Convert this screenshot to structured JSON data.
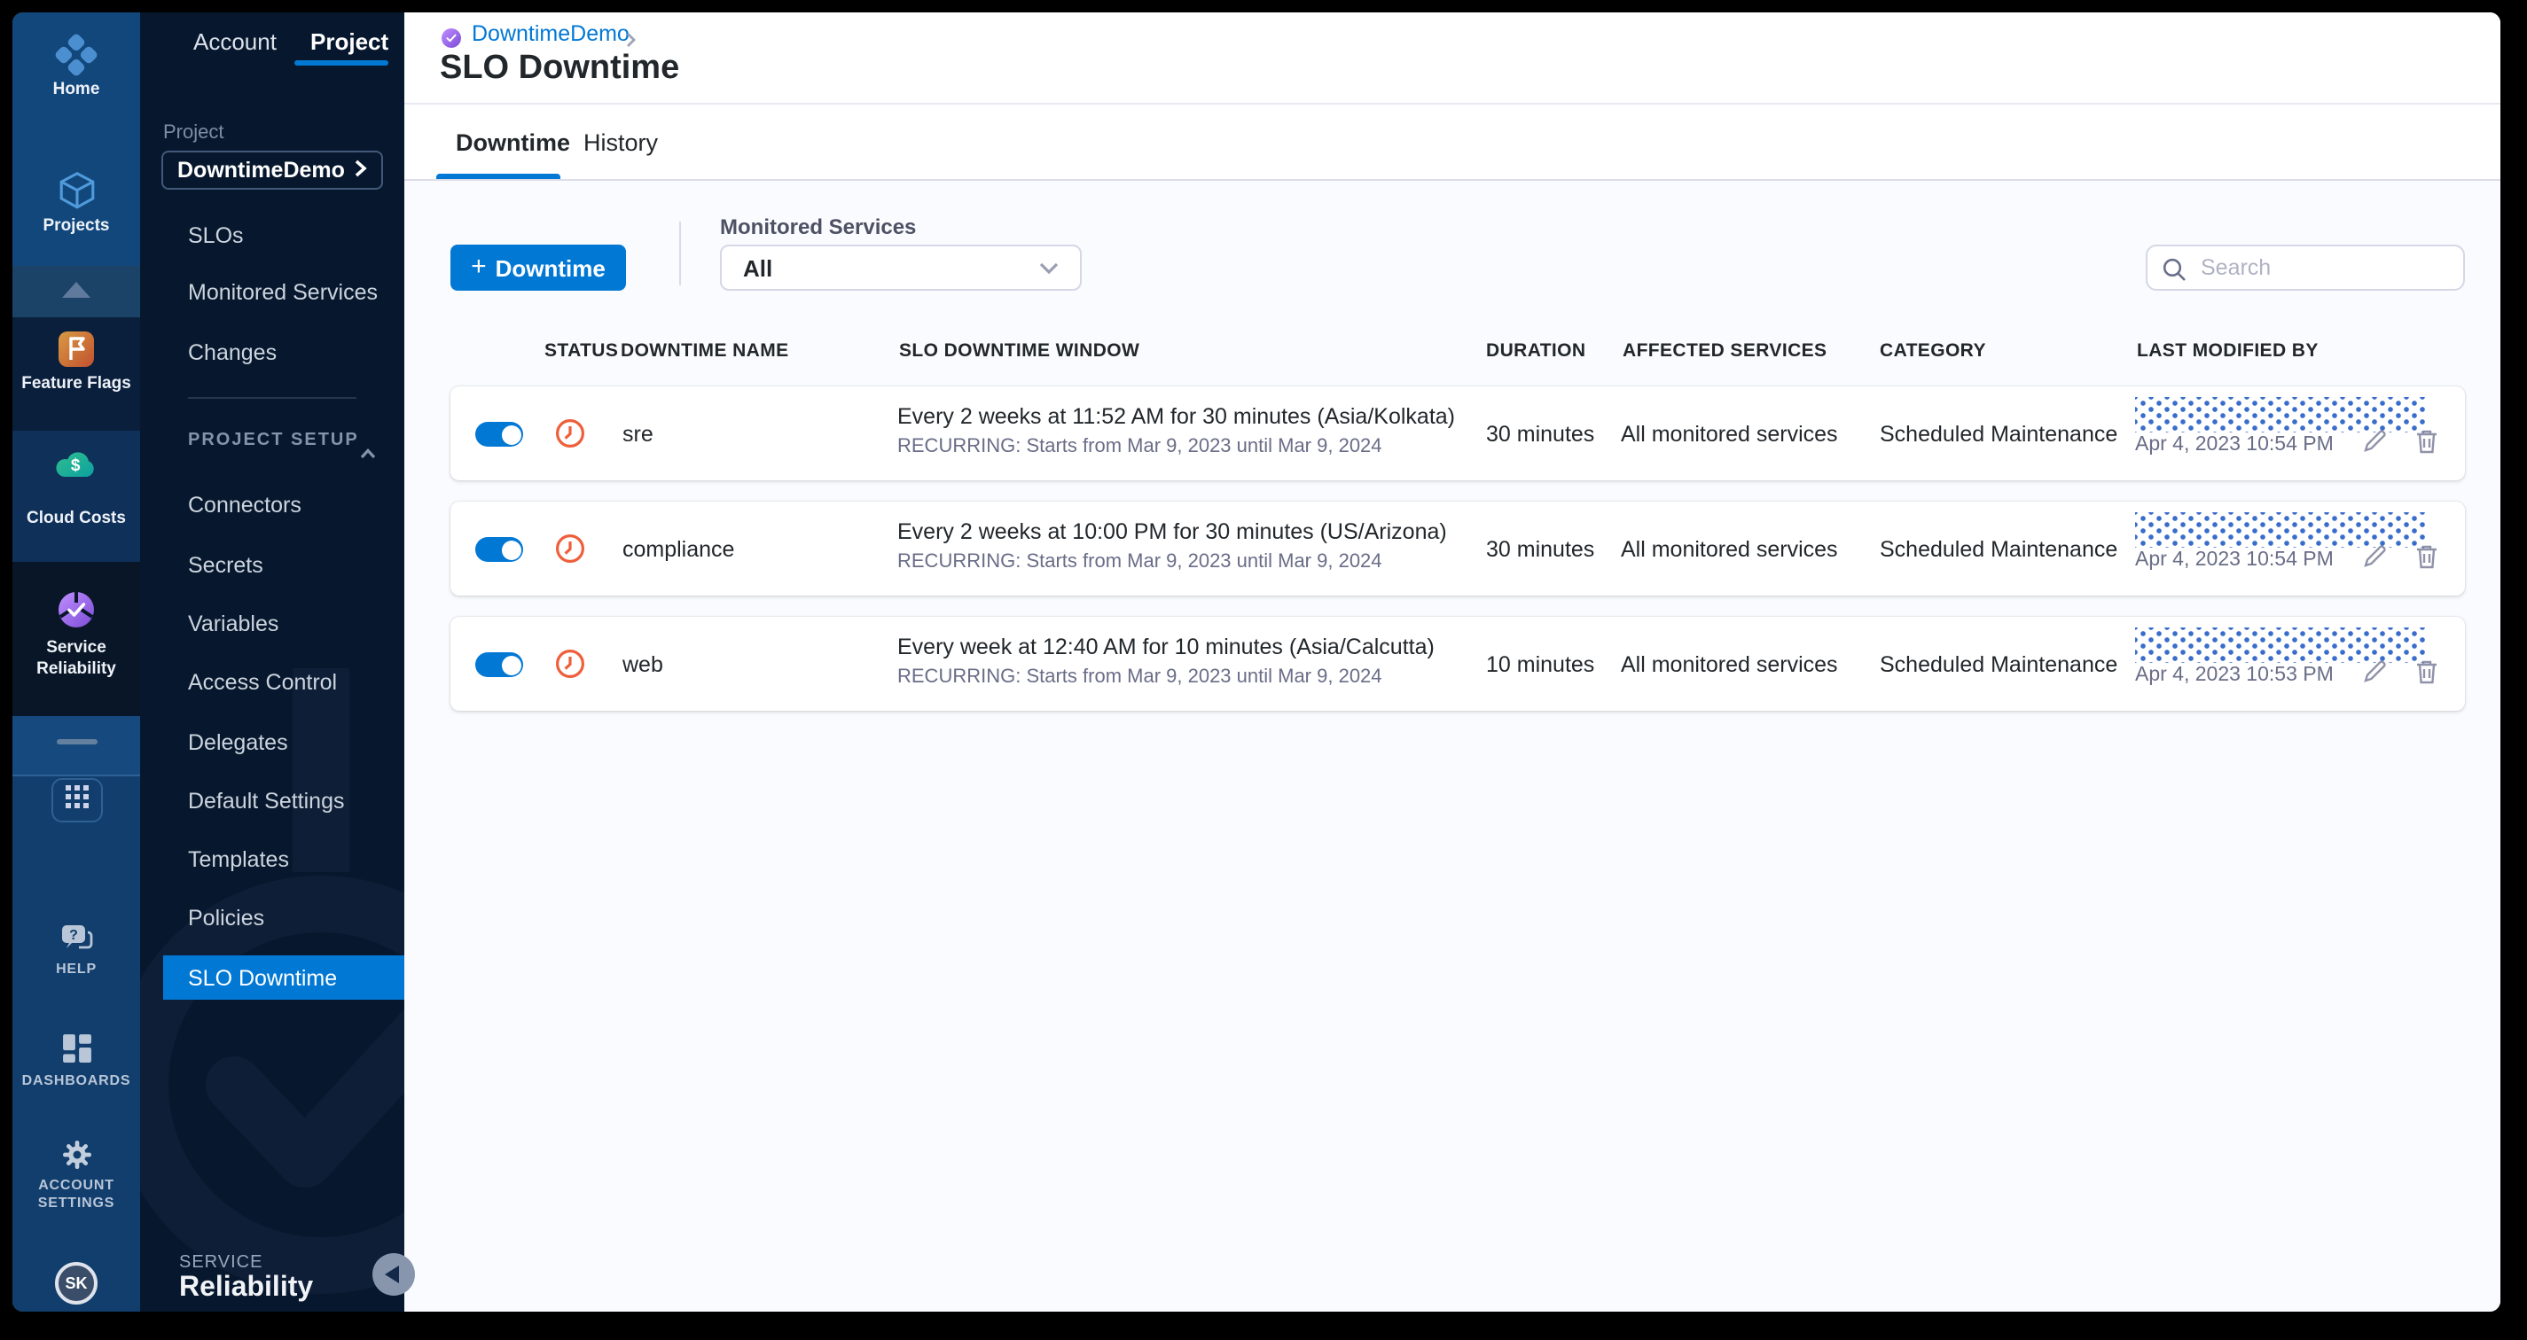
{
  "rail": {
    "home_label": "Home",
    "projects_label": "Projects",
    "feature_flags_label": "Feature Flags",
    "cloud_costs_label": "Cloud Costs",
    "srm_label_1": "Service",
    "srm_label_2": "Reliability",
    "help_label": "HELP",
    "dashboards_label": "DASHBOARDS",
    "account_label_1": "ACCOUNT",
    "account_label_2": "SETTINGS",
    "avatar_initials": "SK"
  },
  "subnav": {
    "tabs": {
      "account": "Account",
      "project": "Project"
    },
    "project_label": "Project",
    "project_selector": "DowntimeDemo",
    "menu": [
      "SLOs",
      "Monitored Services",
      "Changes"
    ],
    "setup_label": "PROJECT SETUP",
    "setup_menu": [
      "Connectors",
      "Secrets",
      "Variables",
      "Access Control",
      "Delegates",
      "Default Settings",
      "Templates",
      "Policies"
    ],
    "active_item": "SLO Downtime",
    "footer_kicker": "SERVICE",
    "footer_title": "Reliability"
  },
  "header": {
    "breadcrumb_project": "DowntimeDemo",
    "title": "SLO Downtime",
    "tab_downtime": "Downtime",
    "tab_history": "History"
  },
  "toolbar": {
    "add_plus": "+",
    "add_label": "Downtime",
    "filter_label": "Monitored Services",
    "filter_value": "All",
    "search_placeholder": "Search"
  },
  "table": {
    "columns": [
      "STATUS",
      "DOWNTIME NAME",
      "SLO DOWNTIME WINDOW",
      "DURATION",
      "AFFECTED SERVICES",
      "CATEGORY",
      "LAST MODIFIED BY"
    ],
    "rows": [
      {
        "enabled": "on",
        "name": "sre",
        "window_line1": "Every 2 weeks at 11:52 AM for 30 minutes (Asia/Kolkata)",
        "window_line2": "RECURRING: Starts from Mar 9, 2023 until Mar 9, 2024",
        "duration": "30 minutes",
        "affected_services": "All monitored services",
        "category": "Scheduled Maintenance",
        "last_modified": "Apr 4, 2023 10:54 PM"
      },
      {
        "enabled": "on",
        "name": "compliance",
        "window_line1": "Every 2 weeks at 10:00 PM for 30 minutes (US/Arizona)",
        "window_line2": "RECURRING: Starts from Mar 9, 2023 until Mar 9, 2024",
        "duration": "30 minutes",
        "affected_services": "All monitored services",
        "category": "Scheduled Maintenance",
        "last_modified": "Apr 4, 2023 10:54 PM"
      },
      {
        "enabled": "on",
        "name": "web",
        "window_line1": "Every week at 12:40 AM for 10 minutes (Asia/Calcutta)",
        "window_line2": "RECURRING: Starts from Mar 9, 2023 until Mar 9, 2024",
        "duration": "10 minutes",
        "affected_services": "All monitored services",
        "category": "Scheduled Maintenance",
        "last_modified": "Apr 4, 2023 10:53 PM"
      }
    ]
  },
  "colors": {
    "accent": "#0278D5",
    "clock_icon": "#EE5F3B",
    "redaction_dots": "#3A6DCB",
    "subnav_bg": "#07182E"
  }
}
